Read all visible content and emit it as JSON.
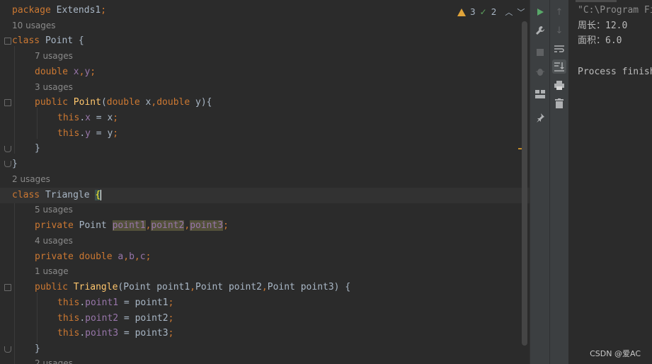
{
  "editor": {
    "inspection": {
      "warnings": "3",
      "checks": "2"
    },
    "lines": {
      "l0": {
        "kw": "package",
        "rest": " Extends1",
        "semi": ";"
      },
      "l1": {
        "hint": "10 usages"
      },
      "l2": {
        "kw": "class",
        "rest": " Point {"
      },
      "l3": {
        "hint": "7 usages"
      },
      "l4": {
        "kw": "double",
        "sp": " ",
        "f1": "x",
        "c1": ",",
        "f2": "y",
        "semi": ";"
      },
      "l5": {
        "hint": "3 usages"
      },
      "l6": {
        "kw": "public",
        "sp": " ",
        "fn": "Point",
        "p1": "(",
        "t1": "double",
        "a1": " x",
        "c1": ",",
        "t2": "double",
        "a2": " y){"
      },
      "l7": {
        "kw": "this",
        "dot": ".",
        "fld": "x",
        "rest": " = x",
        "semi": ";"
      },
      "l8": {
        "kw": "this",
        "dot": ".",
        "fld": "y",
        "rest": " = y",
        "semi": ";"
      },
      "l9": {
        "text": "}"
      },
      "l10": {
        "text": "}"
      },
      "l11": {
        "hint": "2 usages"
      },
      "l12": {
        "kw": "class",
        "rest": " Triangle ",
        "caret": "{"
      },
      "l13": {
        "hint": "5 usages"
      },
      "l14": {
        "kw": "private",
        "rest": " Point ",
        "f1": "point1",
        "c1": ",",
        "f2": "point2",
        "c2": ",",
        "f3": "point3",
        "semi": ";"
      },
      "l15": {
        "hint": "4 usages"
      },
      "l16": {
        "kw": "private",
        "sp": " ",
        "kw2": "double",
        "sp2": " ",
        "f1": "a",
        "c1": ",",
        "f2": "b",
        "c2": ",",
        "f3": "c",
        "semi": ";"
      },
      "l17": {
        "hint": "1 usage"
      },
      "l18": {
        "kw": "public",
        "sp": " ",
        "fn": "Triangle",
        "p1": "(Point point1",
        "c1": ",",
        "p2": "Point point2",
        "c2": ",",
        "p3": "Point point3) {"
      },
      "l19": {
        "kw": "this",
        "dot": ".",
        "fld": "point1",
        "rest": " = point1",
        "semi": ";"
      },
      "l20": {
        "kw": "this",
        "dot": ".",
        "fld": "point2",
        "rest": " = point2",
        "semi": ";"
      },
      "l21": {
        "kw": "this",
        "dot": ".",
        "fld": "point3",
        "rest": " = point3",
        "semi": ";"
      },
      "l22": {
        "text": "}"
      },
      "l23": {
        "hint": "2 usages"
      }
    }
  },
  "toolbar": {
    "run_icon": "run-icon",
    "wrench_icon": "wrench-icon",
    "stop_icon": "stop-icon",
    "debug_icon": "bug-icon",
    "layout_icon": "layout-icon",
    "pin_icon": "pin-icon",
    "up_icon": "arrow-up-icon",
    "down_icon": "arrow-down-icon",
    "wrap_icon": "soft-wrap-icon",
    "scroll_icon": "scroll-to-end-icon",
    "print_icon": "print-icon",
    "trash_icon": "trash-icon"
  },
  "console": {
    "line1": "\"C:\\Program Fi",
    "line2": "周长：12.0",
    "line3": "面积：6.0",
    "line4": "Process finish"
  },
  "watermark": "CSDN @爱AC",
  "colors": {
    "background": "#2b2b2b",
    "keyword": "#cc7832",
    "method": "#ffc66d",
    "field": "#9876aa",
    "text": "#a9b7c6",
    "hint": "#8a8a8a",
    "run_green": "#59a869"
  }
}
